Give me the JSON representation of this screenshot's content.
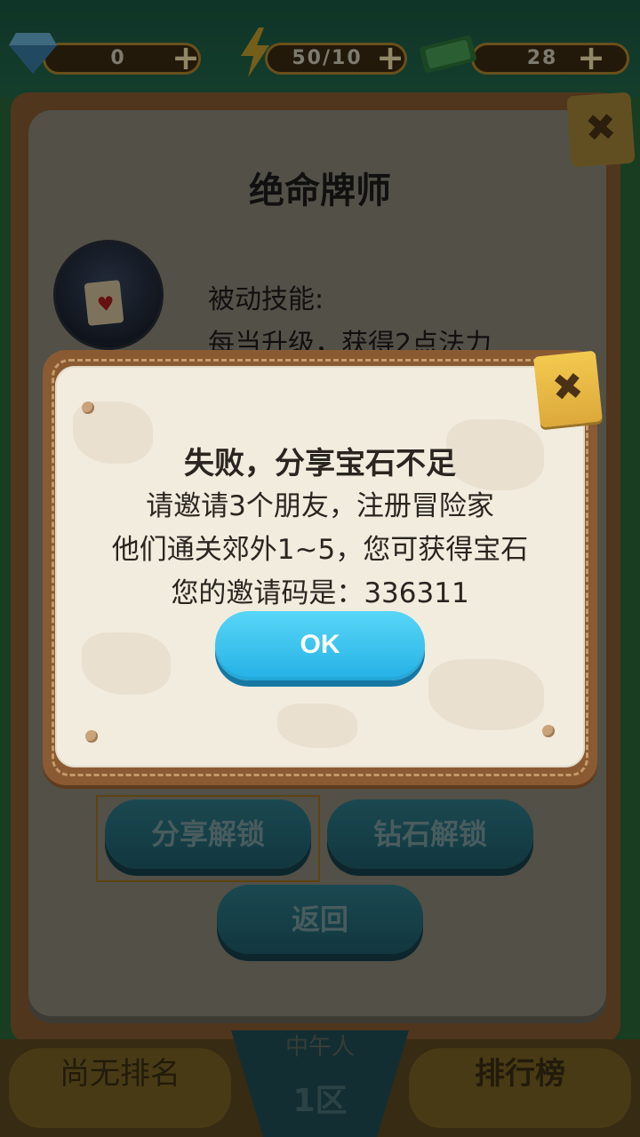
{
  "resources": {
    "gems": {
      "value": "0",
      "icon": "diamond-icon"
    },
    "energy": {
      "value": "50/10",
      "icon": "lightning-icon"
    },
    "cash": {
      "value": "28",
      "icon": "money-icon"
    },
    "plus": "+"
  },
  "hero_panel": {
    "title": "绝命牌师",
    "skill_label": "被动技能:",
    "skill_desc": "每当升级，获得2点法力",
    "share_unlock": "分享解锁",
    "diamond_unlock": "钻石解锁",
    "back": "返回",
    "close_icon": "close-icon"
  },
  "bottom_bar": {
    "rank": "尚无排名",
    "server_name": "中午人",
    "zone": "1区",
    "leaderboard": "排行榜"
  },
  "dialog": {
    "title": "失败，分享宝石不足",
    "line1": "请邀请3个朋友，注册冒险家",
    "line2": "他们通关郊外1~5，您可获得宝石",
    "line3": "您的邀请码是：336311",
    "ok": "OK",
    "close_symbol": "✖"
  },
  "colors": {
    "ok_button": "#24b1e5",
    "paper": "#f2ecdf",
    "frame": "#8a5a32"
  }
}
